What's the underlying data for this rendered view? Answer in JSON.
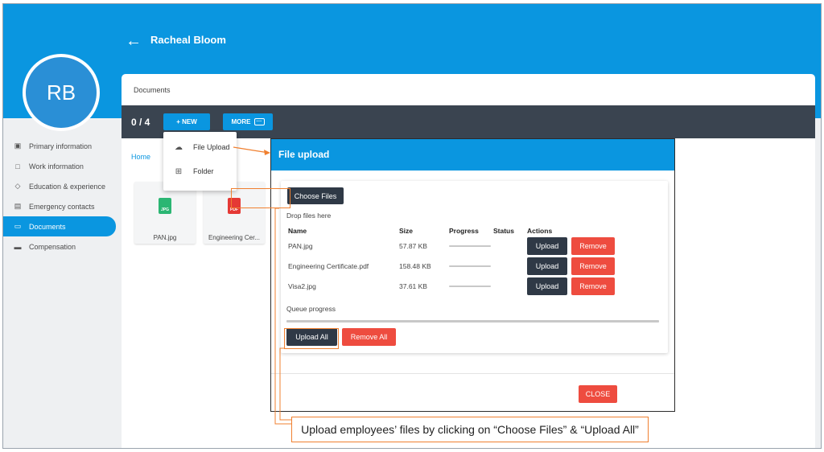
{
  "header": {
    "back_icon": "arrow-left-icon",
    "user_name": "Racheal Bloom",
    "avatar_initials": "RB"
  },
  "sidebar": {
    "items": [
      {
        "label": "Primary information",
        "icon": "id-card-icon",
        "glyph": "▣",
        "active": false
      },
      {
        "label": "Work information",
        "icon": "briefcase-icon",
        "glyph": "□",
        "active": false
      },
      {
        "label": "Education & experience",
        "icon": "graduation-cap-icon",
        "glyph": "◇",
        "active": false
      },
      {
        "label": "Emergency contacts",
        "icon": "contacts-card-icon",
        "glyph": "▤",
        "active": false
      },
      {
        "label": "Documents",
        "icon": "folder-icon",
        "glyph": "▭",
        "active": true
      },
      {
        "label": "Compensation",
        "icon": "money-card-icon",
        "glyph": "▬",
        "active": false
      }
    ]
  },
  "panel": {
    "title": "Documents"
  },
  "toolbar": {
    "count": "0 / 4",
    "new_label": "+ NEW",
    "more_label": "MORE",
    "more_icon": "dots-icon"
  },
  "breadcrumb": {
    "home": "Home"
  },
  "files": [
    {
      "name": "PAN.jpg",
      "icon": "jpg-file-icon",
      "badge": "JPG",
      "color": "#2bb673"
    },
    {
      "name": "Engineering Cer...",
      "icon": "pdf-file-icon",
      "badge": "PDF",
      "color": "#e53935"
    }
  ],
  "dropdown": {
    "items": [
      {
        "label": "File Upload",
        "icon": "cloud-upload-icon",
        "glyph": "☁"
      },
      {
        "label": "Folder",
        "icon": "new-folder-icon",
        "glyph": "⊞"
      }
    ]
  },
  "modal": {
    "title": "File upload",
    "choose_files": "Choose Files",
    "drop_text": "Drop files here",
    "columns": {
      "name": "Name",
      "size": "Size",
      "progress": "Progress",
      "status": "Status",
      "actions": "Actions"
    },
    "rows": [
      {
        "name": "PAN.jpg",
        "size": "57.87 KB",
        "progress": 0,
        "status": "",
        "upload": "Upload",
        "remove": "Remove"
      },
      {
        "name": "Engineering Certificate.pdf",
        "size": "158.48 KB",
        "progress": 0,
        "status": "",
        "upload": "Upload",
        "remove": "Remove"
      },
      {
        "name": "Visa2.jpg",
        "size": "37.61 KB",
        "progress": 0,
        "status": "",
        "upload": "Upload",
        "remove": "Remove"
      }
    ],
    "queue_label": "Queue progress",
    "queue_progress": 0,
    "upload_all": "Upload All",
    "remove_all": "Remove All",
    "close": "CLOSE"
  },
  "annotation": {
    "text": "Upload employees’ files by clicking on “Choose Files” & “Upload All”",
    "color": "#f08030"
  },
  "colors": {
    "primary": "#0a96e0",
    "toolbar": "#3a4450",
    "danger": "#ee4c3f",
    "dark_button": "#2f3946"
  }
}
